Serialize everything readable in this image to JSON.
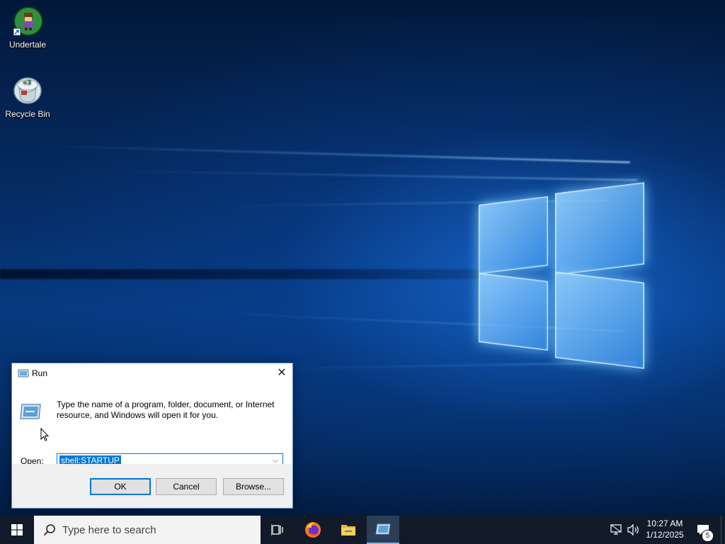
{
  "desktop": {
    "icons": [
      {
        "label": "Undertale"
      },
      {
        "label": "Recycle Bin"
      }
    ]
  },
  "run_dialog": {
    "title": "Run",
    "description": "Type the name of a program, folder, document, or Internet resource, and Windows will open it for you.",
    "open_label": "Open:",
    "open_value": "shell:STARTUP",
    "buttons": {
      "ok": "OK",
      "cancel": "Cancel",
      "browse": "Browse..."
    }
  },
  "taskbar": {
    "search_placeholder": "Type here to search",
    "clock": {
      "time": "10:27 AM",
      "date": "1/12/2025"
    },
    "notification_count": "5"
  },
  "colors": {
    "accent": "#0078d7",
    "taskbar": "#101a29"
  }
}
